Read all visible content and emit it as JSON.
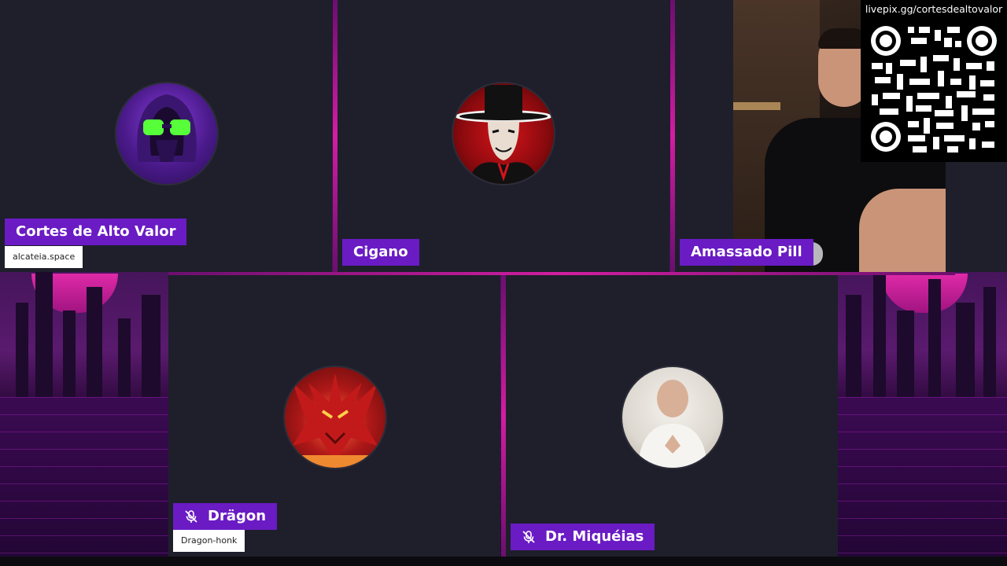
{
  "livepix_url": "livepix.gg/cortesdealtovalor",
  "participants": [
    {
      "name": "Cortes de Alto Valor",
      "tag": "alcateia.space",
      "muted": false
    },
    {
      "name": "Cigano",
      "tag": "",
      "muted": false
    },
    {
      "name": "Amassado Pill",
      "tag": "",
      "muted": false
    },
    {
      "name": "Drägon",
      "tag": "Dragon-honk",
      "muted": true
    },
    {
      "name": "Dr. Miquéias",
      "tag": "",
      "muted": true
    }
  ],
  "colors": {
    "nameplate": "#6a1bc4",
    "tile": "#1e1f2b",
    "accent": "#d21ea0"
  },
  "icons": {
    "muted": "mic-off-icon",
    "qr": "qr-code-icon"
  }
}
